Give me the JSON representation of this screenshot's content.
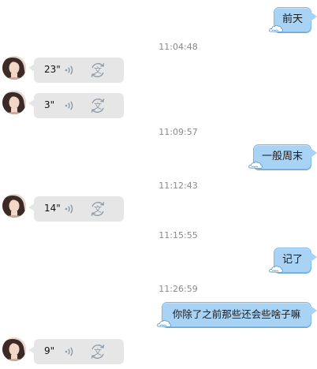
{
  "messages": {
    "out_1": {
      "text": "前天"
    },
    "in_1": {
      "duration": "23\""
    },
    "in_2": {
      "duration": "3\""
    },
    "out_2": {
      "text": "一般周末"
    },
    "in_3": {
      "duration": "14\""
    },
    "out_3": {
      "text": "记了"
    },
    "out_4": {
      "text": "你除了之前那些还会些啥子嘛"
    },
    "in_4": {
      "duration": "9\""
    }
  },
  "timestamps": {
    "t1": "11:04:48",
    "t2": "11:09:57",
    "t3": "11:12:43",
    "t4": "11:15:55",
    "t5": "11:26:59"
  },
  "icons": {
    "voice": "voice-wave-icon",
    "translate": "translate-icon",
    "bubble_decoration": "cloud-icon"
  },
  "colors": {
    "outgoing_bubble": "#a8d3f5",
    "incoming_bubble": "#e6e6e6",
    "timestamp_text": "#8a8a8a"
  }
}
